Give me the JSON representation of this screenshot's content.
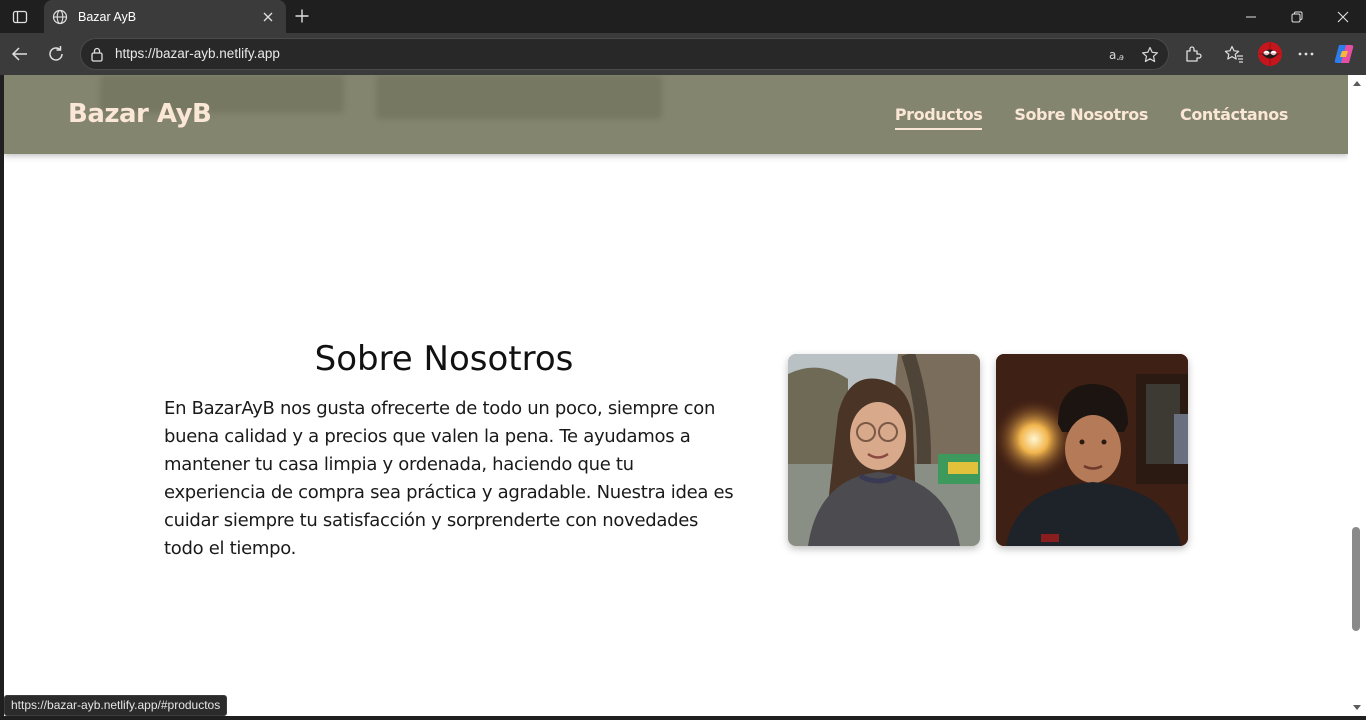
{
  "browser": {
    "tab_title": "Bazar AyB",
    "url": "https://bazar-ayb.netlify.app",
    "status_url": "https://bazar-ayb.netlify.app/#productos",
    "icons": {
      "tab_actions": "tab-actions-icon",
      "favicon": "globe-icon",
      "tab_close": "close-icon",
      "new_tab": "plus-icon",
      "minimize": "minimize-icon",
      "restore": "restore-icon",
      "close_window": "close-icon",
      "back": "back-arrow-icon",
      "refresh": "refresh-icon",
      "site_info": "lock-icon",
      "translate": "translate-icon",
      "favorite": "star-icon",
      "extensions": "puzzle-icon",
      "favorites": "favorites-icon",
      "profile": "avatar",
      "menu": "more-icon",
      "copilot": "copilot-icon"
    }
  },
  "site": {
    "brand": "Bazar AyB",
    "nav": [
      {
        "label": "Productos",
        "active": true
      },
      {
        "label": "Sobre Nosotros",
        "active": false
      },
      {
        "label": "Contáctanos",
        "active": false
      }
    ],
    "colors": {
      "header_bg": "#84856f",
      "header_text": "#fbe7d5"
    }
  },
  "about": {
    "title": "Sobre Nosotros",
    "text": "En BazarAyB nos gusta ofrecerte de todo un poco, siempre con buena calidad y a precios que valen la pena. Te ayudamos a mantener tu casa limpia y ordenada, haciendo que tu experiencia de compra sea práctica y agradable. Nuestra idea es cuidar siempre tu satisfacción y sorprenderte con novedades todo el tiempo.",
    "photos": [
      "team-photo-woman",
      "team-photo-man"
    ]
  }
}
